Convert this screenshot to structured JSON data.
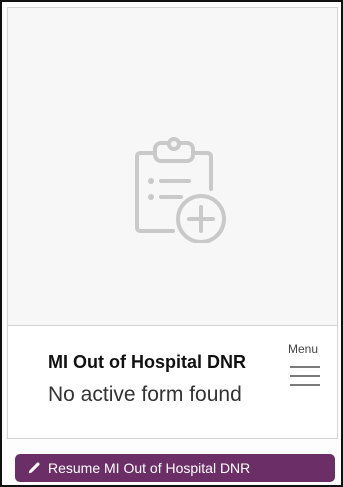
{
  "card": {
    "thumbnail_icon": "clipboard-add-icon",
    "title": "MI Out of Hospital DNR",
    "status": "No active form found",
    "menu_label": "Menu",
    "menu_icon": "hamburger-menu-icon"
  },
  "resume_button": {
    "label": "Resume MI Out of Hospital DNR",
    "icon": "pencil-icon",
    "color": "#6b2e67"
  },
  "colors": {
    "icon_gray": "#c9c9c9",
    "border": "#d4d4d4"
  }
}
